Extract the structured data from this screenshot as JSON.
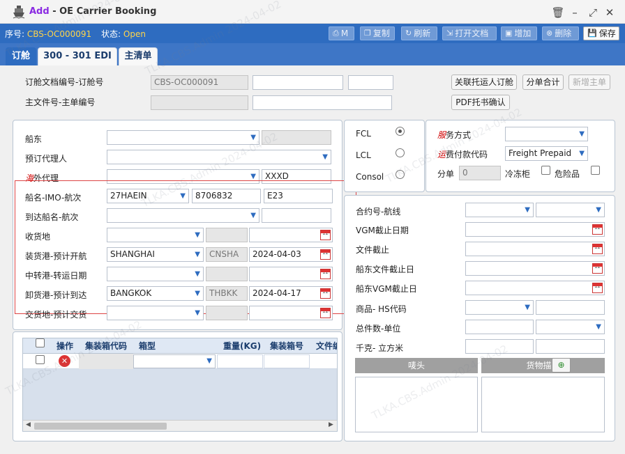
{
  "window": {
    "title_prefix": "Add",
    "title_rest": " - OE Carrier Booking",
    "icon": "ship-icon"
  },
  "status": {
    "serial_label": "序号:",
    "serial_value": "CBS-OC000091",
    "state_label": "状态:",
    "state_value": "Open"
  },
  "toolbar": {
    "print": "M",
    "copy": "复制",
    "refresh": "刷新",
    "open_doc": "打开文档",
    "add": "增加",
    "delete": "删除",
    "save": "保存"
  },
  "tabs": [
    "订舱",
    "300 - 301 EDI",
    "主清单"
  ],
  "top": {
    "booking_label": "订舱文档编号-订舱号",
    "booking_no": "CBS-OC000091",
    "master_label": "主文件号-主单编号",
    "btn_link": "关联托运人订舱",
    "btn_split": "分单合计",
    "btn_new_master": "新增主单",
    "btn_pdf": "PDF托书确认"
  },
  "left": {
    "carrier_label": "船东",
    "booking_agent_label": "预订代理人",
    "overseas_red": "海",
    "overseas_rest": "外代理",
    "overseas_value": "XXXD",
    "vessel_label": "船名-IMO-航次",
    "vessel_value": "27HAEIN",
    "imo_value": "8706832",
    "voyage_value": "E23",
    "arrival_vessel_label": "到达船名-航次",
    "receipt_label": "收货地",
    "pol_label": "装货港-预计开航",
    "pol_value": "SHANGHAI",
    "pol_code": "CNSHA",
    "etd": "2024-04-03",
    "transship_label": "中转港-转运日期",
    "pod_label": "卸货港-预计到达",
    "pod_value": "BANGKOK",
    "pod_code": "THBKK",
    "eta": "2024-04-17",
    "delivery_label": "交货地-预计交货"
  },
  "load": {
    "fcl": "FCL",
    "lcl": "LCL",
    "consol": "Consol",
    "selected": "FCL"
  },
  "service": {
    "svc_red": "服",
    "svc_rest": "务方式",
    "freight_red": "运",
    "freight_rest": "费付款代码",
    "freight_value": "Freight Prepaid",
    "split_label": "分单",
    "split_value": "0",
    "reefer_label": "冷冻柜",
    "dg_label": "危险品"
  },
  "right": {
    "contract_label": "合约号-航线",
    "vgm_cutoff_label": "VGM截止日期",
    "doc_cutoff_label": "文件截止",
    "carrier_doc_label": "船东文件截止日",
    "carrier_vgm_label": "船东VGM截止日",
    "hs_label": "商品- HS代码",
    "pkg_label": "总件数-单位",
    "weight_label": "千克- 立方米",
    "marks_label": "唛头",
    "desc_label": "货物描述"
  },
  "grid": {
    "columns": [
      "操作",
      "集装箱代码",
      "箱型",
      "重量(KG)",
      "集装箱号",
      "文件编"
    ]
  },
  "watermark": "TLKA.CBS.Admin 2024-04-02"
}
